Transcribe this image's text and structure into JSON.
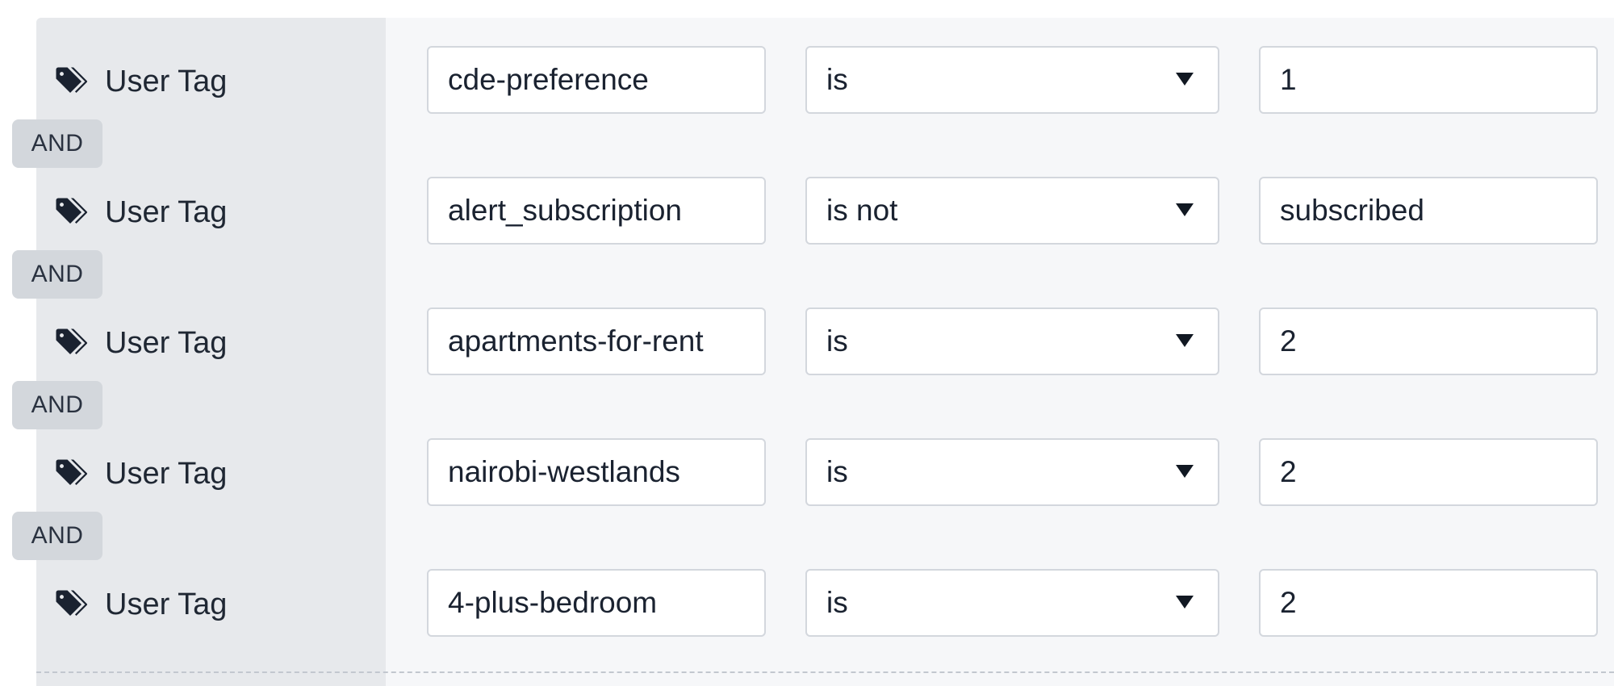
{
  "rules": [
    {
      "type_label": "User Tag",
      "icon": "tag-icon",
      "key": "cde-preference",
      "operator": "is",
      "value": "1"
    },
    {
      "type_label": "User Tag",
      "icon": "tag-icon",
      "key": "alert_subscription",
      "operator": "is not",
      "value": "subscribed"
    },
    {
      "type_label": "User Tag",
      "icon": "tag-icon",
      "key": "apartments-for-rent",
      "operator": "is",
      "value": "2"
    },
    {
      "type_label": "User Tag",
      "icon": "tag-icon",
      "key": "nairobi-westlands",
      "operator": "is",
      "value": "2"
    },
    {
      "type_label": "User Tag",
      "icon": "tag-icon",
      "key": "4-plus-bedroom",
      "operator": "is",
      "value": "2"
    }
  ],
  "connectors": [
    "AND",
    "AND",
    "AND",
    "AND"
  ]
}
